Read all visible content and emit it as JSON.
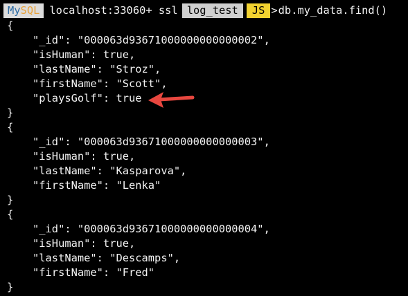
{
  "prompt": {
    "mode_my": "My",
    "mode_sql": "SQL",
    "host": "localhost:33060+ ssl",
    "schema": "log_test",
    "lang": "JS",
    "caret": ">",
    "command": "db.my_data.find()"
  },
  "documents": [
    {
      "open": "{",
      "lines": [
        "\"_id\": \"000063d93671000000000000002\",",
        "\"isHuman\": true,",
        "\"lastName\": \"Stroz\",",
        "\"firstName\": \"Scott\",",
        "\"playsGolf\": true"
      ],
      "close": "}"
    },
    {
      "open": "{",
      "lines": [
        "\"_id\": \"000063d93671000000000000003\",",
        "\"isHuman\": true,",
        "\"lastName\": \"Kasparova\",",
        "\"firstName\": \"Lenka\""
      ],
      "close": "}"
    },
    {
      "open": "{",
      "lines": [
        "\"_id\": \"000063d93671000000000000004\",",
        "\"isHuman\": true,",
        "\"lastName\": \"Descamps\",",
        "\"firstName\": \"Fred\""
      ],
      "close": "}"
    }
  ],
  "annotation": {
    "arrow_color": "#e8473f",
    "icon": "left-arrow-icon"
  }
}
